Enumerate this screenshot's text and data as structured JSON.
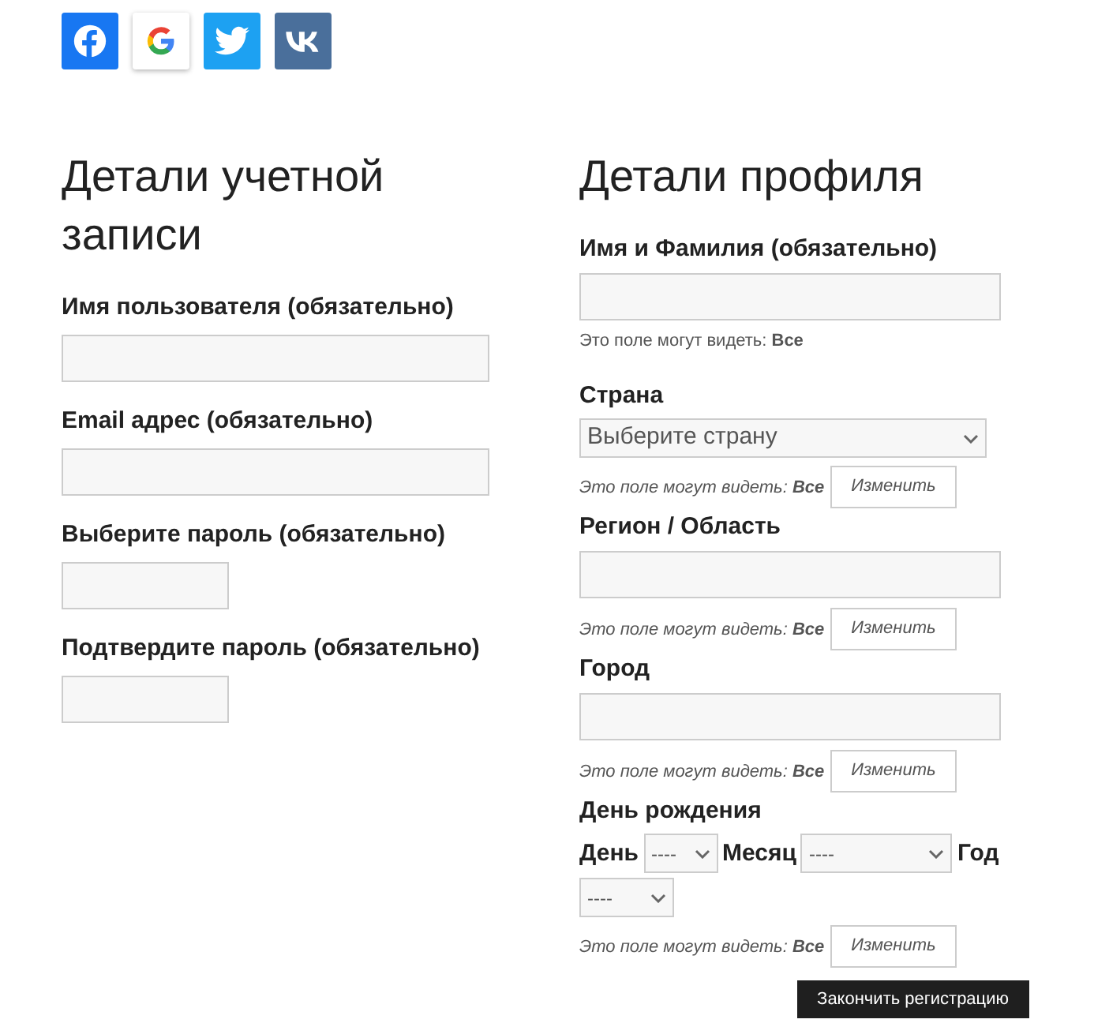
{
  "social_buttons": [
    {
      "kind": "facebook"
    },
    {
      "kind": "google"
    },
    {
      "kind": "twitter"
    },
    {
      "kind": "vk"
    }
  ],
  "account": {
    "title": "Детали учетной записи",
    "fields": [
      {
        "kind": "text",
        "label": "Имя пользователя (обязательно)"
      },
      {
        "kind": "text",
        "label": "Email адрес (обязательно)"
      },
      {
        "kind": "password",
        "label": "Выберите пароль (обязательно)"
      },
      {
        "kind": "password",
        "label": "Подтвердите пароль (обязательно)"
      }
    ]
  },
  "profile": {
    "title": "Детали профиля",
    "fields": [
      {
        "kind": "text",
        "label": "Имя и Фамилия (обязательно)",
        "visibility": {
          "text": "Это поле могут видеть: **Все**"
        }
      },
      {
        "kind": "select",
        "label": "Страна",
        "placeholder": "Выберите страну",
        "visibility": {
          "text": "Это поле могут видеть: **Все**",
          "button": "Изменить"
        }
      },
      {
        "kind": "text",
        "label": "Регион / Область",
        "visibility": {
          "text": "Это поле могут видеть: **Все**",
          "button": "Изменить"
        }
      },
      {
        "kind": "text",
        "label": "Город",
        "visibility": {
          "text": "Это поле могут видеть: **Все**",
          "button": "Изменить"
        }
      },
      {
        "kind": "date",
        "label": "День рождения",
        "items": [
          {
            "kind": "label",
            "text": "День"
          },
          {
            "kind": "day",
            "value": "----"
          },
          {
            "kind": "label",
            "text": "Месяц"
          },
          {
            "kind": "month",
            "value": "----"
          },
          {
            "kind": "label",
            "text": "Год"
          },
          {
            "kind": "year",
            "value": "----"
          }
        ],
        "visibility": {
          "text": "Это поле могут видеть: **Все**",
          "button": "Изменить"
        }
      }
    ]
  },
  "submit": "Закончить регистрацию"
}
